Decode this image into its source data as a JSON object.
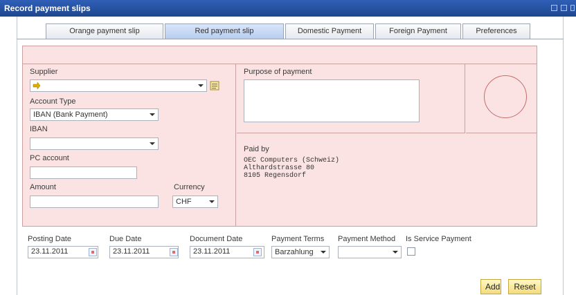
{
  "window": {
    "title": "Record payment slips"
  },
  "tabs": [
    {
      "label": "Orange payment slip"
    },
    {
      "label": "Red payment slip"
    },
    {
      "label": "Domestic Payment"
    },
    {
      "label": "Foreign Payment"
    },
    {
      "label": "Preferences"
    }
  ],
  "form": {
    "supplier": {
      "label": "Supplier",
      "value": ""
    },
    "account_type": {
      "label": "Account Type",
      "value": "IBAN (Bank Payment)"
    },
    "iban": {
      "label": "IBAN",
      "value": ""
    },
    "pc_account": {
      "label": "PC account",
      "value": ""
    },
    "amount": {
      "label": "Amount",
      "value": ""
    },
    "currency": {
      "label": "Currency",
      "value": "CHF"
    },
    "purpose": {
      "label": "Purpose of payment",
      "value": ""
    },
    "paid_by": {
      "label": "Paid by",
      "lines": [
        "OEC Computers (Schweiz)",
        "Althardstrasse 80",
        "8105 Regensdorf"
      ]
    }
  },
  "footer": {
    "posting_date": {
      "label": "Posting Date",
      "value": "23.11.2011"
    },
    "due_date": {
      "label": "Due Date",
      "value": "23.11.2011"
    },
    "document_date": {
      "label": "Document Date",
      "value": "23.11.2011"
    },
    "payment_terms": {
      "label": "Payment Terms",
      "value": "Barzahlung"
    },
    "payment_method": {
      "label": "Payment Method",
      "value": ""
    },
    "is_service_payment": {
      "label": "Is Service Payment",
      "checked": false
    }
  },
  "buttons": {
    "add": "Add",
    "reset": "Reset"
  },
  "colors": {
    "title_bar": "#2f5fb6",
    "pink_panel": "#fbe3e3",
    "active_tab": "#b7cdee",
    "button_yellow": "#f3dc7c"
  }
}
